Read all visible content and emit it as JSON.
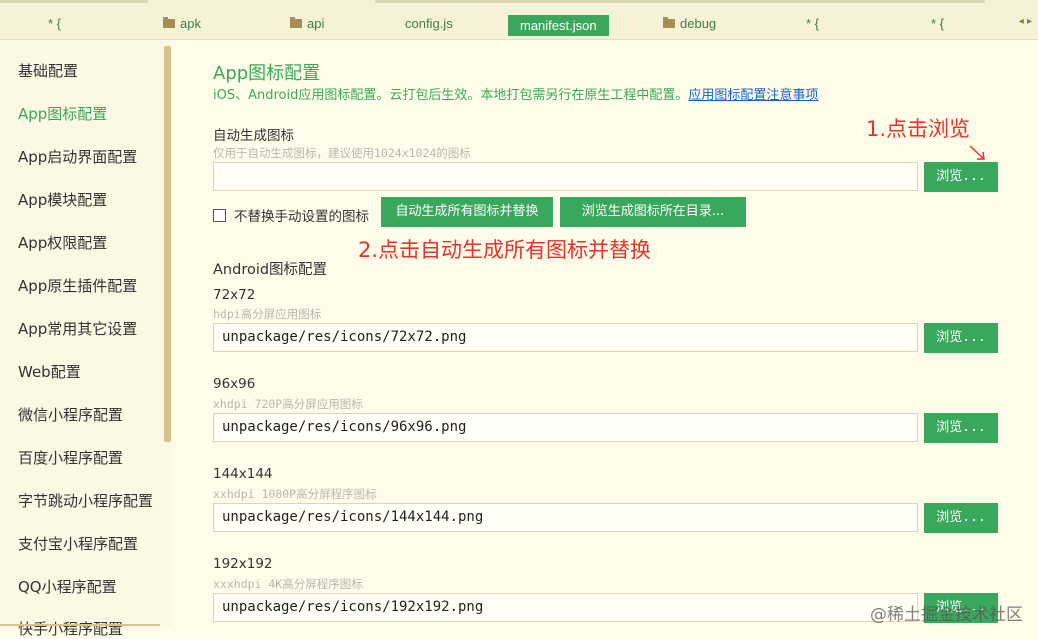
{
  "tabs": [
    {
      "label": "* {",
      "icon": ""
    },
    {
      "label": "apk",
      "icon": "folder-icon"
    },
    {
      "label": "api",
      "icon": "folder-icon"
    },
    {
      "label": "config.js",
      "icon": ""
    },
    {
      "label": "manifest.json",
      "icon": "",
      "active": true
    },
    {
      "label": "debug",
      "icon": "folder-icon"
    },
    {
      "label": "* {",
      "icon": ""
    },
    {
      "label": "* {",
      "icon": ""
    }
  ],
  "tab_nav": "◂ ▸",
  "sidebar": {
    "items": [
      {
        "label": "基础配置"
      },
      {
        "label": "App图标配置",
        "active": true
      },
      {
        "label": "App启动界面配置"
      },
      {
        "label": "App模块配置"
      },
      {
        "label": "App权限配置"
      },
      {
        "label": "App原生插件配置"
      },
      {
        "label": "App常用其它设置"
      },
      {
        "label": "Web配置"
      },
      {
        "label": "微信小程序配置"
      },
      {
        "label": "百度小程序配置"
      },
      {
        "label": "字节跳动小程序配置"
      },
      {
        "label": "支付宝小程序配置"
      },
      {
        "label": "QQ小程序配置"
      },
      {
        "label": "快手小程序配置"
      }
    ]
  },
  "main": {
    "title": "App图标配置",
    "description": "iOS、Android应用图标配置。云打包后生效。本地打包需另行在原生工程中配置。",
    "description_link": "应用图标配置注意事项",
    "auto": {
      "label": "自动生成图标",
      "hint": "仅用于自动生成图标，建议使用1024x1024的图标",
      "value": "",
      "browse_label": "浏览...",
      "checkbox_label": "不替换手动设置的图标",
      "checkbox_checked": false,
      "generate_button": "自动生成所有图标并替换",
      "open_dir_button": "浏览生成图标所在目录..."
    },
    "android_section_title": "Android图标配置",
    "icons": [
      {
        "size": "72x72",
        "hint": "hdpi高分屏应用图标",
        "value": "unpackage/res/icons/72x72.png",
        "browse_label": "浏览..."
      },
      {
        "size": "96x96",
        "hint": "xhdpi 720P高分屏应用图标",
        "value": "unpackage/res/icons/96x96.png",
        "browse_label": "浏览..."
      },
      {
        "size": "144x144",
        "hint": "xxhdpi 1080P高分屏程序图标",
        "value": "unpackage/res/icons/144x144.png",
        "browse_label": "浏览..."
      },
      {
        "size": "192x192",
        "hint": "xxxhdpi 4K高分屏程序图标",
        "value": "unpackage/res/icons/192x192.png",
        "browse_label": "浏览..."
      }
    ]
  },
  "annotations": {
    "step1": "1.点击浏览",
    "step2": "2.点击自动生成所有图标并替换",
    "color": "#e8322d"
  },
  "watermark": "@稀土掘金技术社区",
  "colors": {
    "accent": "#3aa85c",
    "link": "#1a63c5",
    "background": "#fffde9"
  }
}
